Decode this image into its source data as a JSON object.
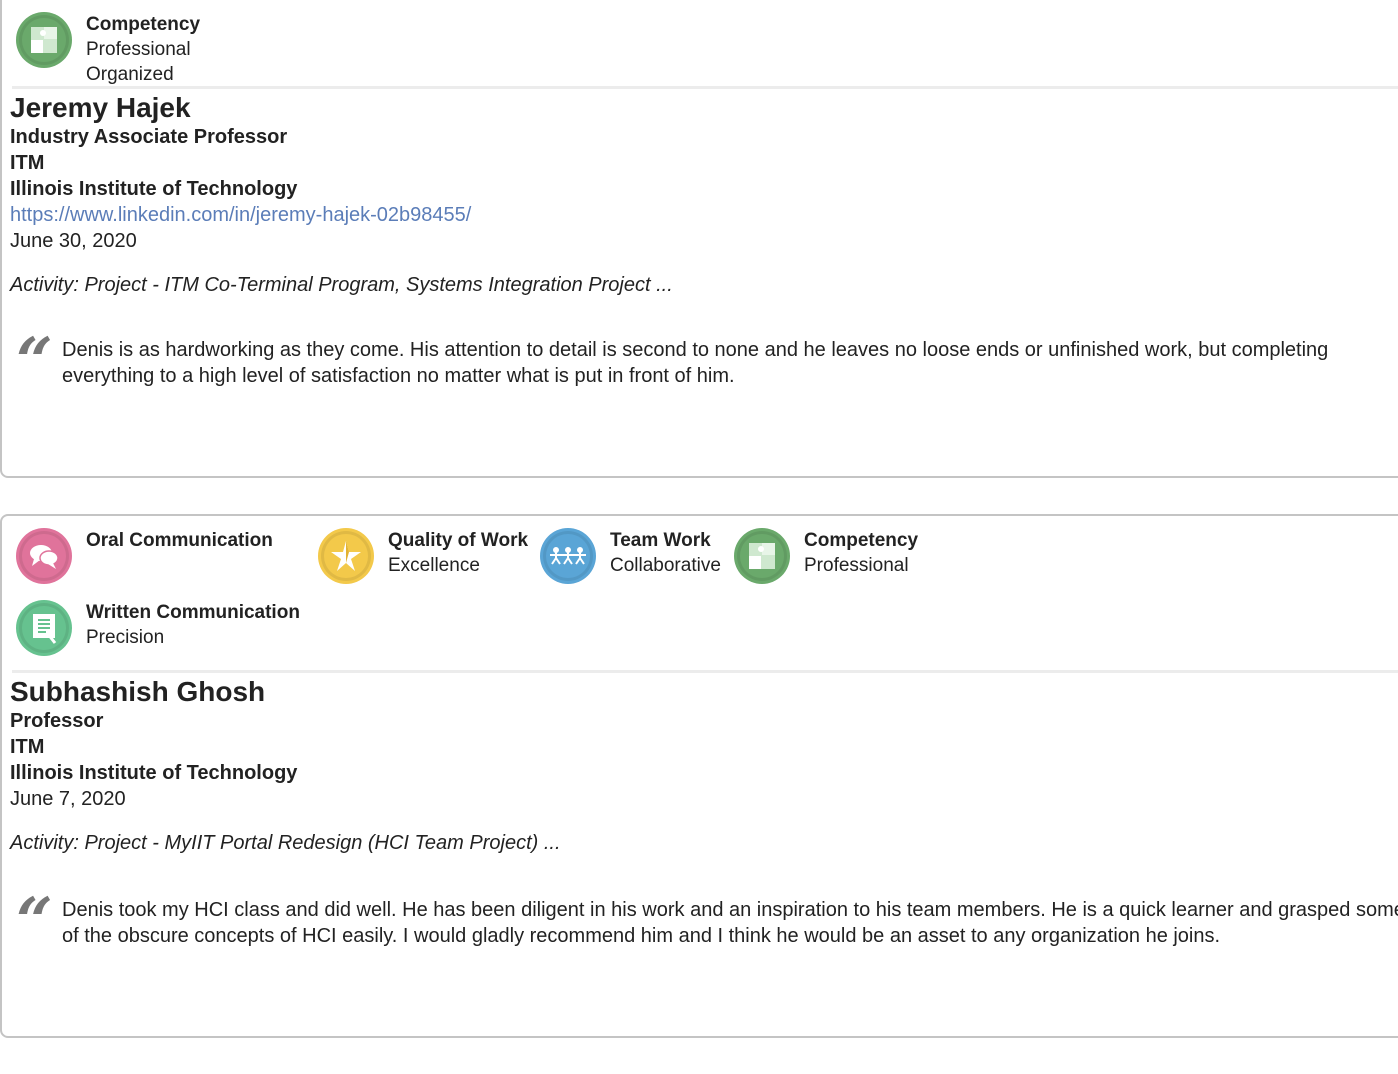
{
  "recommendations": [
    {
      "badges": [
        {
          "title": "Competency",
          "lines": [
            "Professional",
            "Organized"
          ],
          "icon": "puzzle-icon",
          "color": "#6aa96b"
        }
      ],
      "name": "Jeremy Hajek",
      "position": "Industry Associate Professor",
      "department": "ITM",
      "institution": "Illinois Institute of Technology",
      "link": "https://www.linkedin.com/in/jeremy-hajek-02b98455/",
      "date": "June 30, 2020",
      "activity": "Activity: Project - ITM Co-Terminal Program, Systems Integration Project ...",
      "quote": "Denis is as hardworking as they come. His attention to detail is second to none and he leaves no loose ends or unfinished work, but completing everything to a high level of satisfaction no matter what is put in front of him."
    },
    {
      "badges": [
        {
          "title": "Oral Communication",
          "lines": [],
          "icon": "speech-bubbles-icon",
          "color": "#e0739b"
        },
        {
          "title": "Quality of Work",
          "lines": [
            "Excellence"
          ],
          "icon": "star-icon",
          "color": "#f3c94a"
        },
        {
          "title": "Team Work",
          "lines": [
            "Collaborative"
          ],
          "icon": "people-icon",
          "color": "#5aa5d6"
        },
        {
          "title": "Competency",
          "lines": [
            "Professional"
          ],
          "icon": "puzzle-icon",
          "color": "#6aa96b"
        },
        {
          "title": "Written Communication",
          "lines": [
            "Precision"
          ],
          "icon": "document-icon",
          "color": "#66c28f"
        }
      ],
      "name": "Subhashish Ghosh",
      "position": "Professor",
      "department": "ITM",
      "institution": "Illinois Institute of Technology",
      "date": "June 7, 2020",
      "activity": "Activity: Project - MyIIT Portal Redesign (HCI Team Project) ...",
      "quote": "Denis took my HCI class and did well. He has been diligent in his work and an inspiration to his team members. He is a quick learner and grasped some of the obscure concepts of HCI easily. I would gladly recommend him and I think he would be an asset to any organization he joins."
    }
  ]
}
